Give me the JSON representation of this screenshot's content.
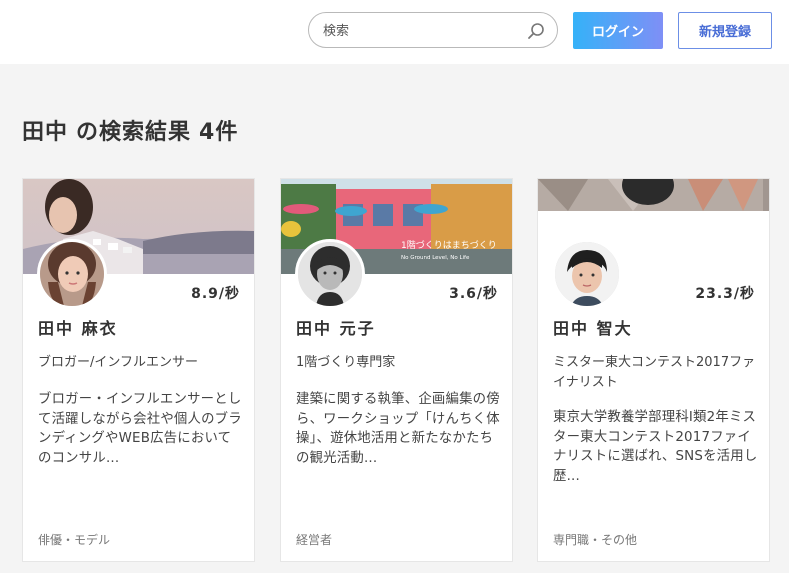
{
  "search": {
    "placeholder": "検索",
    "icon": "search-icon"
  },
  "header": {
    "login_label": "ログイン",
    "register_label": "新規登録",
    "accent": "#35b2f8"
  },
  "results": {
    "query": "田中",
    "suffix": "の検索結果",
    "count": "4件"
  },
  "cards": [
    {
      "rate": "8.9/秒",
      "name": "田中 麻衣",
      "title": "ブロガー/インフルエンサー",
      "bio": "ブロガー・インフルエンサーとして活躍しながら会社や個人のブランディングやWEB広告においてのコンサル...",
      "category": "俳優・モデル"
    },
    {
      "rate": "3.6/秒",
      "name": "田中 元子",
      "title": "1階づくり専門家",
      "bio": "建築に関する執筆、企画編集の傍ら、ワークショップ「けんちく体操」、遊休地活用と新たなかたちの観光活動...",
      "category": "経営者",
      "cover_text": "1階づくりはまちづくり",
      "cover_subtext": "No Ground Level, No Life"
    },
    {
      "rate": "23.3/秒",
      "name": "田中 智大",
      "title": "ミスター東大コンテスト2017ファイナリスト",
      "bio": "東京大学教養学部理科I類2年ミスター東大コンテスト2017ファイナリストに選ばれ、SNSを活用し歴...",
      "category": "専門職・その他"
    }
  ]
}
